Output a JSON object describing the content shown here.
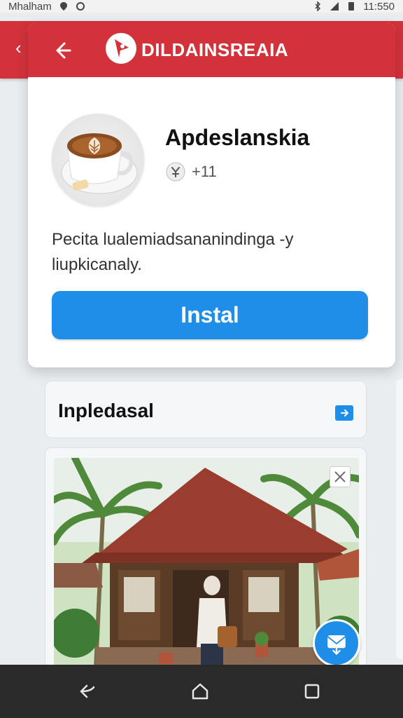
{
  "status_bar": {
    "carrier": "Mhalham",
    "time": "11:550"
  },
  "dialog": {
    "brand_name": "DILDAINSREAIA",
    "app_name": "Apdeslanskia",
    "app_meta": "+11",
    "description": "Pecita lualemiadsananindinga -y liupkicanaly.",
    "install_label": "Instal"
  },
  "section": {
    "title": "Inpledasal"
  },
  "icons": {
    "back": "arrow-left-icon",
    "brand": "brand-logo",
    "meta": "rating-icon",
    "section_arrow": "arrow-right-icon",
    "close": "close-icon",
    "fab": "mail-download-icon",
    "nav_back": "nav-back-icon",
    "nav_home": "nav-home-icon",
    "nav_recents": "nav-recents-icon"
  },
  "colors": {
    "brand_red": "#d3323a",
    "accent_blue": "#1f8ee8",
    "nav_dark": "#2a2a2a"
  }
}
